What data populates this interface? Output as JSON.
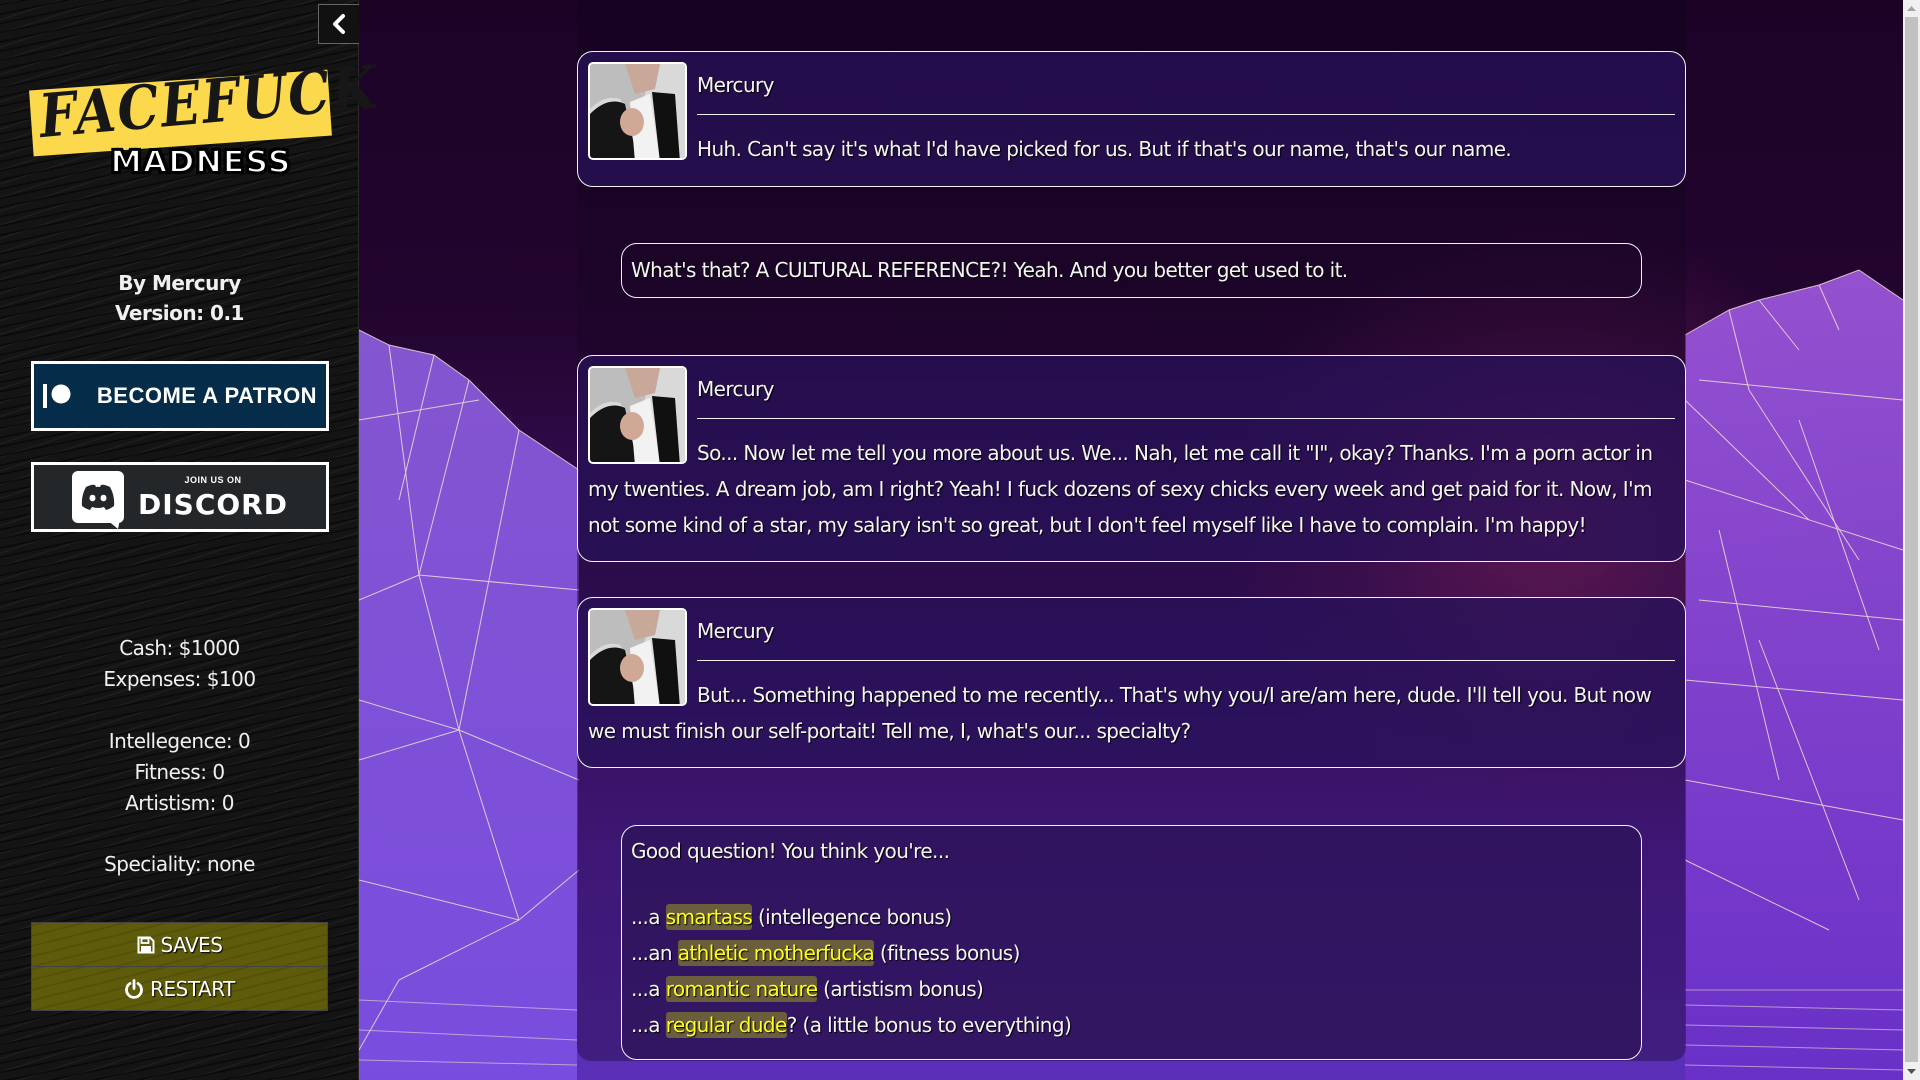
{
  "sidebar": {
    "collapse_icon": "chevron-left-icon",
    "logo": {
      "title": "FACEFUCK",
      "subtitle": "MADNESS",
      "band_color": "#fcd84d"
    },
    "author": "By Mercury",
    "version": "Version: 0.1",
    "patreon_button": {
      "label": "BECOME A PATRON",
      "icon": "patreon-icon",
      "bg_color": "#052d49"
    },
    "discord_button": {
      "small_label": "JOIN US ON",
      "big_label": "DISCORD",
      "icon": "discord-icon",
      "bg_color": "#23272a"
    },
    "stats": {
      "cash": "Cash: $1000",
      "expenses": "Expenses: $100",
      "intellegence": "Intellegence: 0",
      "fitness": "Fitness: 0",
      "artistism": "Artistism: 0",
      "speciality": "Speciality: none"
    },
    "menu": {
      "saves": {
        "label": "SAVES",
        "icon": "floppy-disk-icon"
      },
      "restart": {
        "label": "RESTART",
        "icon": "power-icon"
      },
      "bg_color": "#5e5b0a"
    }
  },
  "story": {
    "messages": [
      {
        "speaker": "Mercury",
        "avatar": "mercury-portrait",
        "text": "Huh. Can't say it's what I'd have picked for us. But if that's our name, that's our name."
      },
      {
        "speaker": "Mercury",
        "avatar": "mercury-portrait",
        "text": "So... Now let me tell you more about us. We... Nah, let me call it \"I\", okay? Thanks. I'm a porn actor in my twenties. A dream job, am I right? Yeah! I fuck dozens of sexy chicks every week and get paid for it. Now, I'm not some kind of a star, my salary isn't so great, but I don't feel myself like I have to complain. I'm happy!"
      },
      {
        "speaker": "Mercury",
        "avatar": "mercury-portrait",
        "text": "But... Something happened to me recently... That's why you/I are/am here, dude. I'll tell you. But now we must finish our self-portait! Tell me, I, what's our... specialty?"
      }
    ],
    "narration": "What's that? A CULTURAL REFERENCE?! Yeah. And you better get used to it.",
    "choice_prompt": "Good question! You think you're...",
    "choices": [
      {
        "prefix": "...a ",
        "link": "smartass",
        "suffix": " (intellegence bonus)"
      },
      {
        "prefix": "...an ",
        "link": "athletic motherfucka",
        "suffix": " (fitness bonus)"
      },
      {
        "prefix": "...a ",
        "link": "romantic nature",
        "suffix": " (artistism bonus)"
      },
      {
        "prefix": "...a ",
        "link": "regular dude",
        "suffix": "? (a little bonus to everything)"
      }
    ],
    "link_colors": {
      "text": "#ffff1a",
      "background": "#6a5e3c"
    }
  }
}
